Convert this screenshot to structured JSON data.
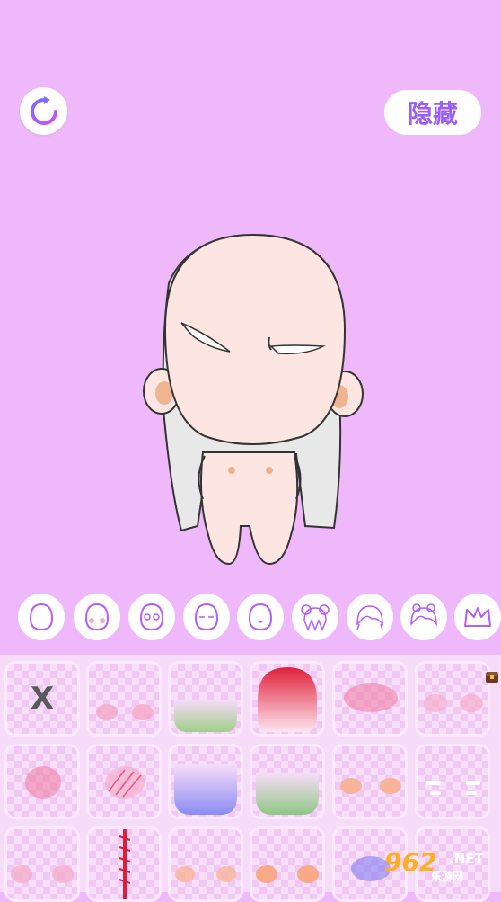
{
  "toolbar": {
    "reset_icon": "refresh-icon",
    "hide_label": "隐藏"
  },
  "character": {
    "description_icon": "chibi-character"
  },
  "categories": [
    {
      "name": "face-shape-icon"
    },
    {
      "name": "blush-face-icon"
    },
    {
      "name": "eyes-face-icon"
    },
    {
      "name": "closed-eyes-face-icon"
    },
    {
      "name": "mouth-face-icon"
    },
    {
      "name": "front-hair-icon"
    },
    {
      "name": "bangs-hair-icon"
    },
    {
      "name": "side-hair-icon"
    },
    {
      "name": "crown-icon"
    }
  ],
  "grid": {
    "none_label": "X"
  },
  "watermark": {
    "logo": "962",
    "net": ".NET",
    "site": "乐游网"
  },
  "colors": {
    "background": "#efb8fb",
    "accent": "#9a5cff",
    "panel": "#f7dcf9"
  }
}
